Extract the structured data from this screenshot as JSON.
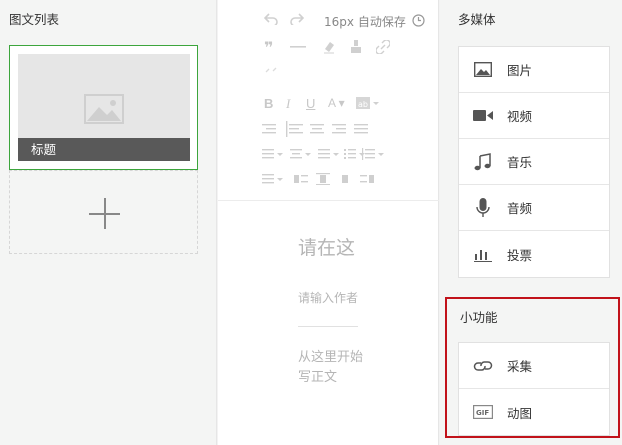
{
  "left_panel": {
    "title": "图文列表",
    "article_caption": "标题"
  },
  "editor": {
    "font_size": "16px",
    "autosave_label": "自动保存",
    "title_placeholder": "请在这",
    "author_placeholder": "请输入作者",
    "body_placeholder": "从这里开始写正文"
  },
  "multimedia": {
    "title": "多媒体",
    "items": [
      {
        "label": "图片",
        "icon": "image-icon"
      },
      {
        "label": "视频",
        "icon": "video-icon"
      },
      {
        "label": "音乐",
        "icon": "music-icon"
      },
      {
        "label": "音频",
        "icon": "microphone-icon"
      },
      {
        "label": "投票",
        "icon": "vote-chart-icon"
      }
    ]
  },
  "tools": {
    "title": "小功能",
    "highlight_color": "#c1121a",
    "items": [
      {
        "label": "采集",
        "icon": "link-collect-icon"
      },
      {
        "label": "动图",
        "icon": "gif-icon"
      }
    ]
  },
  "colors": {
    "selected_border": "#3ca53c",
    "caption_bg": "#595959"
  }
}
